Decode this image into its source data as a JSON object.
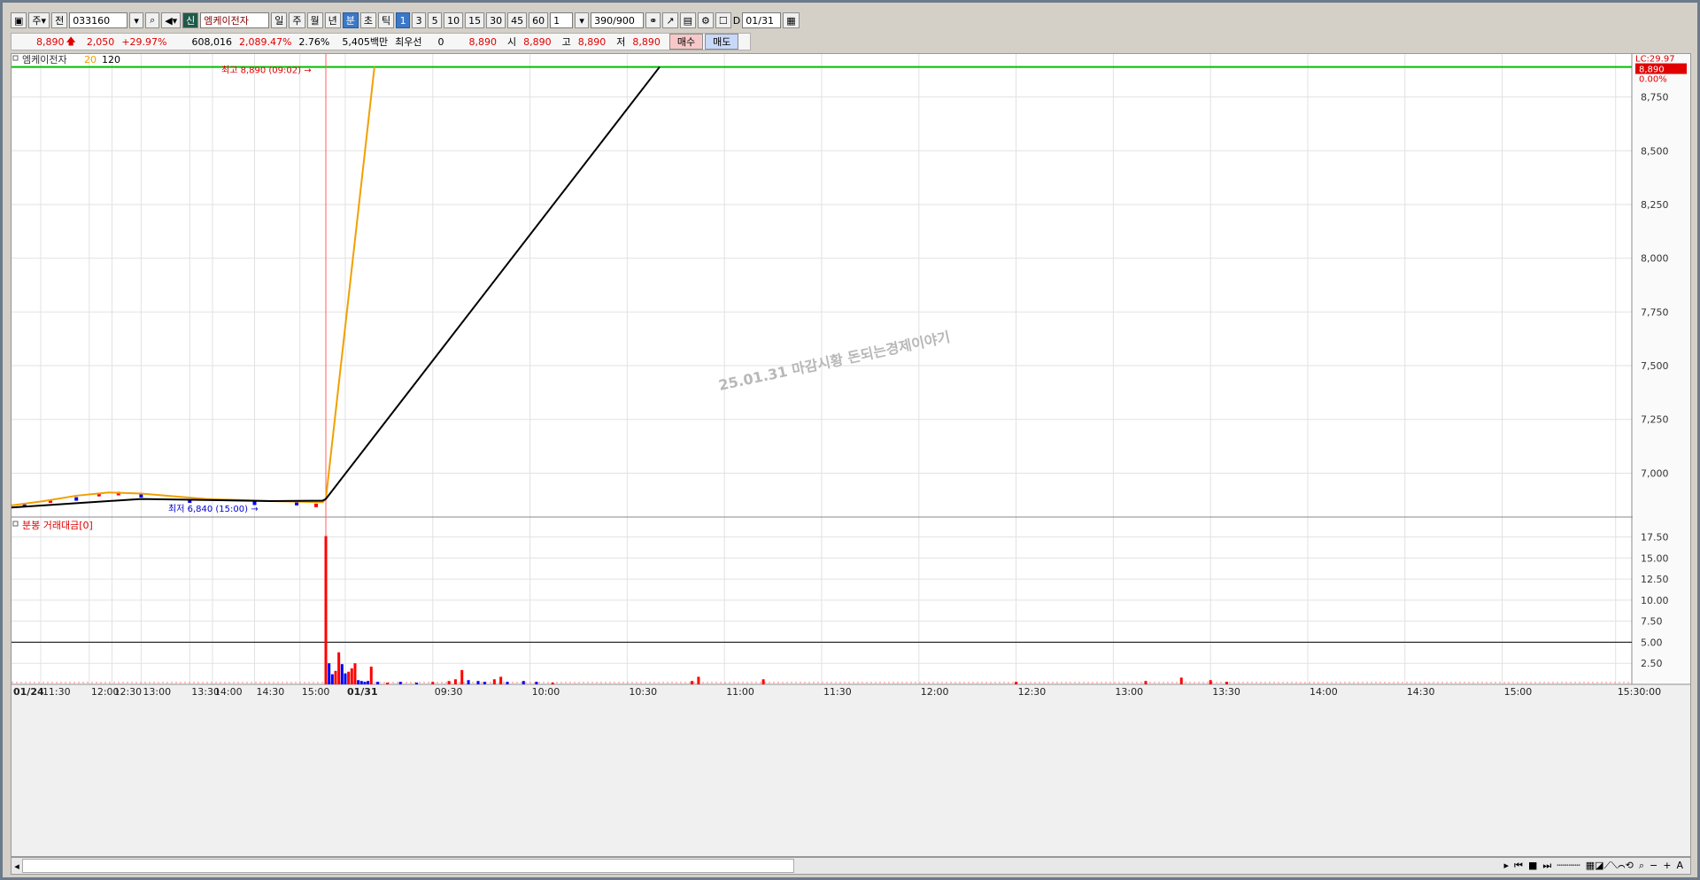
{
  "toolbar": {
    "market": "주",
    "full": "전",
    "code": "033160",
    "badge": "신",
    "name": "엠케이전자",
    "periods": [
      "일",
      "주",
      "월",
      "년",
      "분",
      "초",
      "틱"
    ],
    "minutes": [
      "1",
      "3",
      "5",
      "10",
      "15",
      "30",
      "45",
      "60"
    ],
    "count": "1",
    "range": "390",
    "range_total": "/900",
    "d_label": "D",
    "date": "01/31"
  },
  "quote": {
    "price": "8,890",
    "change": "2,050",
    "pct": "+29.97%",
    "volume": "608,016",
    "vol_pct": "2,089.47%",
    "turnover": "2.76%",
    "amount": "5,405백만",
    "best_label": "최우선",
    "best_val": "0",
    "cur": "8,890",
    "open_label": "시",
    "open": "8,890",
    "high_label": "고",
    "high": "8,890",
    "low_label": "저",
    "low": "8,890",
    "buy": "매수",
    "sell": "매도"
  },
  "watermark": "25.01.31 마감시황 돈되는경제이야기",
  "colors": {
    "up": "#ff0000",
    "down": "#0000ff",
    "ma20": "#f0a000",
    "ma120": "#000000",
    "limit": "#00c000"
  },
  "chart_data": [
    {
      "type": "line",
      "legend": [
        "엠케이전자",
        "20",
        "120"
      ],
      "ylim": [
        6800,
        8950
      ],
      "yticks": [
        "8,750",
        "8,500",
        "8,250",
        "8,000",
        "7,750",
        "7,500",
        "7,250",
        "7,000"
      ],
      "y_tick_values": [
        8750,
        8500,
        8250,
        8000,
        7750,
        7500,
        7250,
        7000
      ],
      "right_labels": {
        "lc": "LC:29.97",
        "price": "8,890",
        "pct": "0.00%"
      },
      "high_annotation": "최고 8,890 (09:02)",
      "low_annotation": "최저 6,840 (15:00)",
      "upper_limit": 8890,
      "separator_x": 97,
      "series": [
        {
          "name": "20",
          "x": [
            0,
            10,
            20,
            30,
            40,
            60,
            80,
            96,
            97,
            112
          ],
          "values": [
            6850,
            6870,
            6895,
            6910,
            6905,
            6880,
            6870,
            6865,
            6880,
            8890
          ]
        },
        {
          "name": "120",
          "x": [
            0,
            20,
            40,
            60,
            80,
            96,
            97,
            200
          ],
          "values": [
            6840,
            6860,
            6880,
            6875,
            6870,
            6872,
            6880,
            8890
          ]
        }
      ],
      "candles": [
        {
          "x": 4,
          "v": 6852,
          "c": "down"
        },
        {
          "x": 12,
          "v": 6870,
          "c": "up"
        },
        {
          "x": 20,
          "v": 6880,
          "c": "down"
        },
        {
          "x": 27,
          "v": 6900,
          "c": "up"
        },
        {
          "x": 33,
          "v": 6905,
          "c": "up"
        },
        {
          "x": 40,
          "v": 6895,
          "c": "down"
        },
        {
          "x": 55,
          "v": 6870,
          "c": "down"
        },
        {
          "x": 75,
          "v": 6860,
          "c": "down"
        },
        {
          "x": 88,
          "v": 6858,
          "c": "down"
        },
        {
          "x": 94,
          "v": 6850,
          "c": "up"
        }
      ]
    },
    {
      "type": "bar",
      "legend": [
        "분봉 거래대금[0]"
      ],
      "ylim": [
        0,
        18.5
      ],
      "yticks": [
        "17.50",
        "15.00",
        "12.50",
        "10.00",
        "7.50",
        "5.00",
        "2.50"
      ],
      "y_tick_values": [
        17.5,
        15,
        12.5,
        10,
        7.5,
        5,
        2.5
      ],
      "reference": 5,
      "bars": [
        {
          "x": 97,
          "v": 17.6,
          "c": "up"
        },
        {
          "x": 98,
          "v": 2.5,
          "c": "down"
        },
        {
          "x": 99,
          "v": 1.2,
          "c": "down"
        },
        {
          "x": 100,
          "v": 1.6,
          "c": "up"
        },
        {
          "x": 101,
          "v": 3.8,
          "c": "up"
        },
        {
          "x": 102,
          "v": 2.4,
          "c": "down"
        },
        {
          "x": 103,
          "v": 1.3,
          "c": "down"
        },
        {
          "x": 104,
          "v": 1.5,
          "c": "up"
        },
        {
          "x": 105,
          "v": 1.9,
          "c": "up"
        },
        {
          "x": 106,
          "v": 2.5,
          "c": "up"
        },
        {
          "x": 107,
          "v": 0.5,
          "c": "down"
        },
        {
          "x": 108,
          "v": 0.4,
          "c": "down"
        },
        {
          "x": 109,
          "v": 0.3,
          "c": "down"
        },
        {
          "x": 110,
          "v": 0.4,
          "c": "down"
        },
        {
          "x": 111,
          "v": 2.1,
          "c": "up"
        },
        {
          "x": 113,
          "v": 0.3,
          "c": "down"
        },
        {
          "x": 116,
          "v": 0.2,
          "c": "up"
        },
        {
          "x": 120,
          "v": 0.3,
          "c": "down"
        },
        {
          "x": 125,
          "v": 0.2,
          "c": "down"
        },
        {
          "x": 130,
          "v": 0.3,
          "c": "up"
        },
        {
          "x": 135,
          "v": 0.4,
          "c": "up"
        },
        {
          "x": 137,
          "v": 0.6,
          "c": "up"
        },
        {
          "x": 139,
          "v": 1.7,
          "c": "up"
        },
        {
          "x": 141,
          "v": 0.5,
          "c": "down"
        },
        {
          "x": 144,
          "v": 0.4,
          "c": "down"
        },
        {
          "x": 146,
          "v": 0.3,
          "c": "down"
        },
        {
          "x": 149,
          "v": 0.6,
          "c": "up"
        },
        {
          "x": 151,
          "v": 0.9,
          "c": "up"
        },
        {
          "x": 153,
          "v": 0.3,
          "c": "down"
        },
        {
          "x": 158,
          "v": 0.4,
          "c": "down"
        },
        {
          "x": 162,
          "v": 0.3,
          "c": "down"
        },
        {
          "x": 167,
          "v": 0.2,
          "c": "up"
        },
        {
          "x": 210,
          "v": 0.4,
          "c": "up"
        },
        {
          "x": 212,
          "v": 0.9,
          "c": "up"
        },
        {
          "x": 232,
          "v": 0.6,
          "c": "up"
        },
        {
          "x": 310,
          "v": 0.3,
          "c": "up"
        },
        {
          "x": 350,
          "v": 0.4,
          "c": "up"
        },
        {
          "x": 361,
          "v": 0.8,
          "c": "up"
        },
        {
          "x": 370,
          "v": 0.5,
          "c": "up"
        },
        {
          "x": 375,
          "v": 0.3,
          "c": "up"
        }
      ]
    }
  ],
  "x_axis": {
    "total": 390,
    "ticks": [
      {
        "x": 0,
        "label": "01/24",
        "bold": true
      },
      {
        "x": 9,
        "label": "11:30"
      },
      {
        "x": 24,
        "label": "12:00"
      },
      {
        "x": 31,
        "label": "12:30"
      },
      {
        "x": 40,
        "label": "13:00"
      },
      {
        "x": 55,
        "label": "13:30"
      },
      {
        "x": 62,
        "label": "14:00"
      },
      {
        "x": 75,
        "label": "14:30"
      },
      {
        "x": 89,
        "label": "15:00"
      },
      {
        "x": 103,
        "label": "01/31",
        "bold": true
      },
      {
        "x": 130,
        "label": "09:30"
      },
      {
        "x": 160,
        "label": "10:00"
      },
      {
        "x": 190,
        "label": "10:30"
      },
      {
        "x": 220,
        "label": "11:00"
      },
      {
        "x": 250,
        "label": "11:30"
      },
      {
        "x": 280,
        "label": "12:00"
      },
      {
        "x": 310,
        "label": "12:30"
      },
      {
        "x": 340,
        "label": "13:00"
      },
      {
        "x": 370,
        "label": "13:30"
      },
      {
        "x": 400,
        "label": "14:00"
      },
      {
        "x": 430,
        "label": "14:30"
      },
      {
        "x": 460,
        "label": "15:00"
      },
      {
        "x": 495,
        "label": "15:30:00"
      }
    ]
  }
}
